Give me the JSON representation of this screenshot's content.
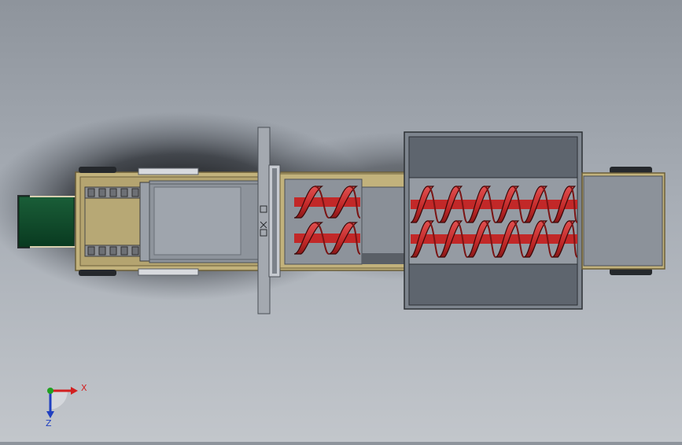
{
  "viewport": {
    "background_top": "#8e949c",
    "background_bottom": "#c2c6cb"
  },
  "colors": {
    "frame": "#c2b27c",
    "frame_dark": "#8a7a4e",
    "steel": "#9aa0a8",
    "steel_dark": "#5a5f66",
    "hopper": "#5f6670",
    "auger": "#cc2e2e",
    "auger_dark": "#7a1414",
    "conveyor_belt": "#0e4a2a",
    "axis_x": "#d22020",
    "axis_y": "#20a020",
    "axis_z": "#2040c0"
  },
  "triad": {
    "x_label": "X",
    "z_label": "Z",
    "icon": "coordinate-triad-icon"
  }
}
